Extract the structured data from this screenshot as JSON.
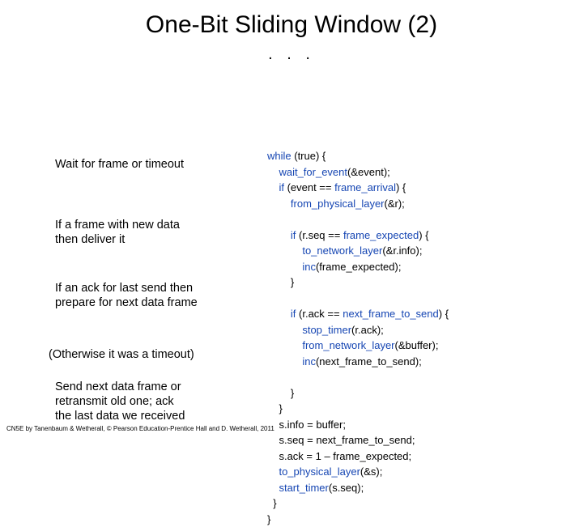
{
  "title": "One-Bit Sliding Window (2)",
  "ellipsis": ". . .",
  "explain": {
    "e1": "Wait for frame or timeout",
    "e2a": "If a frame with new data",
    "e2b": "then deliver it",
    "e3a": "If an ack for last send then",
    "e3b": "prepare for next data frame",
    "e4": "(Otherwise it was a timeout)",
    "e5a": "Send next data frame or",
    "e5b": "retransmit old one;  ack",
    "e5c": "the last data we received"
  },
  "code": {
    "while": "while",
    "t_true": " (true) {",
    "wait_for_event": "wait_for_event",
    "t_ev": "(&event);",
    "if": "if",
    "t_ev_eq": " (event == ",
    "frame_arrival": "frame_arrival",
    "t_cb": ") {",
    "from_physical_layer": "from_physical_layer",
    "t_andr": "(&r);",
    "t_rseq_eq": " (r.seq == ",
    "frame_expected": "frame_expected",
    "to_network_layer": "to_network_layer",
    "t_rinfo": "(&r.info);",
    "inc": "inc",
    "t_fe": "(frame_expected);",
    "t_rack_eq": " (r.ack == ",
    "next_frame_to_send": "next_frame_to_send",
    "stop_timer": "stop_timer",
    "t_rack": "(r.ack);",
    "from_network_layer": "from_network_layer",
    "t_buf": "(&buffer);",
    "t_nfts": "(next_frame_to_send);",
    "s_info": "s.info = buffer;",
    "s_seq": "s.seq = next_frame_to_send;",
    "s_ack": "s.ack = 1 – frame_expected;",
    "to_physical_layer": "to_physical_layer",
    "t_ands": "(&s);",
    "start_timer": "start_timer",
    "t_sseq": "(s.seq);",
    "rb": "}"
  },
  "footer": "CN5E by Tanenbaum & Wetherall, © Pearson Education-Prentice Hall and D. Wetherall, 2011"
}
